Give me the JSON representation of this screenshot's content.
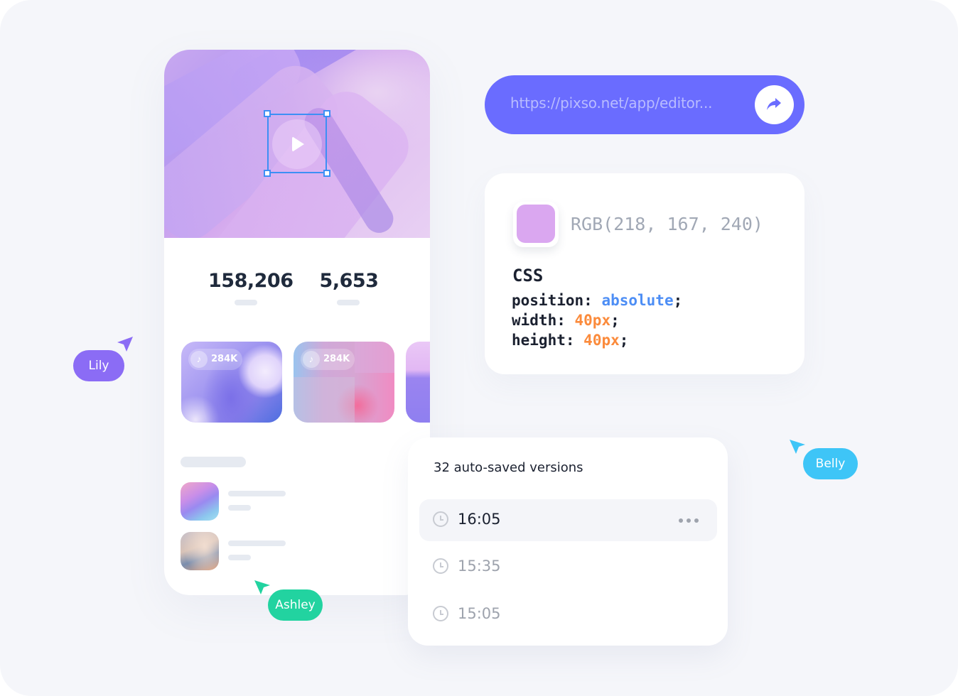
{
  "phone_card": {
    "stats": [
      {
        "value": "158,206"
      },
      {
        "value": "5,653"
      }
    ],
    "media_thumbnails": [
      {
        "badge_icon": "music-note-icon",
        "badge_text": "284K"
      },
      {
        "badge_icon": "music-note-icon",
        "badge_text": "284K"
      },
      {
        "badge_icon": null,
        "badge_text": null
      }
    ],
    "play_icon": "play-icon"
  },
  "url_bar": {
    "url": "https://pixso.net/app/editor...",
    "share_icon": "share-arrow-icon"
  },
  "inspect_card": {
    "color_swatch": "#daa7f0",
    "color_value": "RGB(218, 167, 240)",
    "section_title": "CSS",
    "properties": [
      {
        "name": "position:",
        "value": "absolute",
        "value_color": "#4d8ef5"
      },
      {
        "name": "width:",
        "value": "40px",
        "value_color": "#fb8b3c"
      },
      {
        "name": "height:",
        "value": "40px",
        "value_color": "#fb8b3c"
      }
    ]
  },
  "versions_panel": {
    "title": "32 auto-saved versions",
    "versions": [
      {
        "time": "16:05",
        "active": true
      },
      {
        "time": "15:35",
        "active": false
      },
      {
        "time": "15:05",
        "active": false
      }
    ]
  },
  "collaborators": [
    {
      "name": "Lily",
      "color": "#8b6cf5"
    },
    {
      "name": "Belly",
      "color": "#3ec5f7"
    },
    {
      "name": "Ashley",
      "color": "#22d3a0"
    }
  ],
  "colors": {
    "accent": "#6a6cff",
    "selection": "#3d8ff5",
    "background": "#f5f6fa"
  }
}
